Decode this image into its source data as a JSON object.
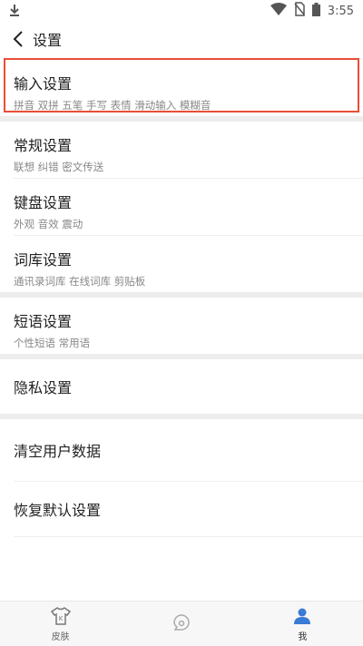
{
  "status_bar": {
    "time": "3:55"
  },
  "header": {
    "title": "设置"
  },
  "sections": {
    "input": {
      "title": "输入设置",
      "subtitle": "拼音 双拼 五笔 手写 表情 滑动输入 模糊音"
    },
    "general": {
      "title": "常规设置",
      "subtitle": "联想 纠错 密文传送"
    },
    "keyboard": {
      "title": "键盘设置",
      "subtitle": "外观 音效 震动"
    },
    "lexicon": {
      "title": "词库设置",
      "subtitle": "通讯录词库 在线词库 剪贴板"
    },
    "phrases": {
      "title": "短语设置",
      "subtitle": "个性短语 常用语"
    },
    "privacy": {
      "title": "隐私设置"
    },
    "clear": {
      "title": "清空用户数据"
    },
    "restore": {
      "title": "恢复默认设置"
    }
  },
  "tabs": [
    {
      "label": "皮肤",
      "icon": "tshirt-icon"
    },
    {
      "label": "",
      "icon": "chat-icon"
    },
    {
      "label": "我",
      "icon": "user-icon",
      "active": true
    }
  ],
  "colors": {
    "highlight": "#e94e35",
    "divider": "#ededed",
    "active_tab": "#3a7bd5"
  }
}
